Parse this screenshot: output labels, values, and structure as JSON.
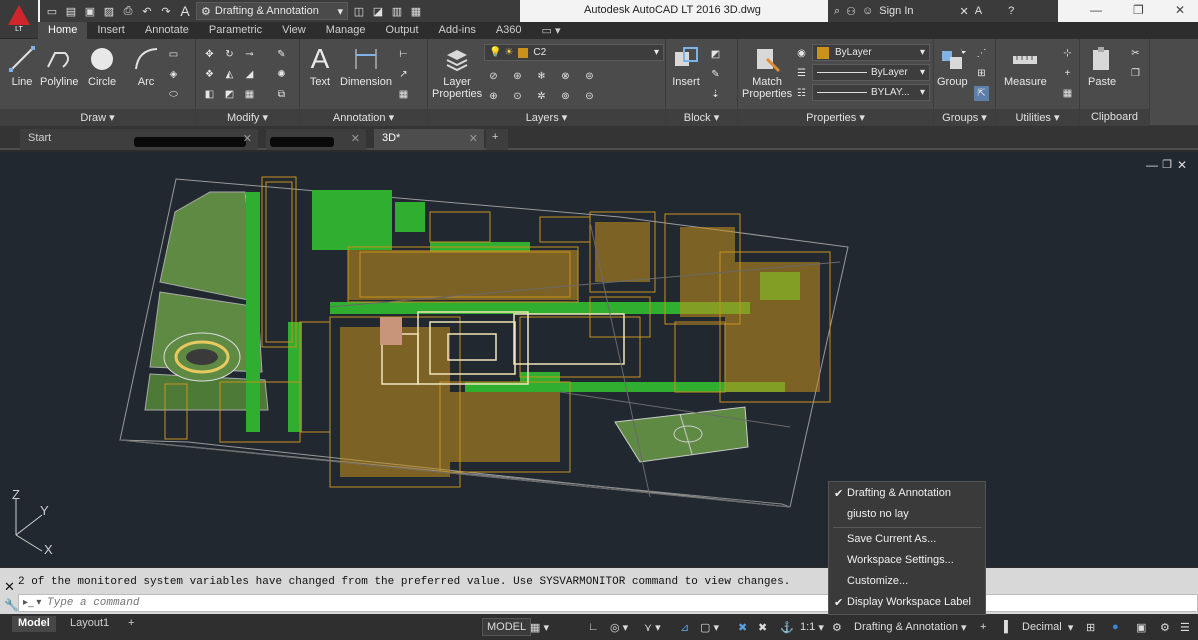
{
  "app": {
    "title": "Autodesk AutoCAD LT 2016    3D.dwg",
    "logo_text": "LT",
    "workspace": "Drafting & Annotation"
  },
  "signin": {
    "label": "Sign In"
  },
  "ribbon_tabs": [
    "Home",
    "Insert",
    "Annotate",
    "Parametric",
    "View",
    "Manage",
    "Output",
    "Add-ins",
    "A360"
  ],
  "panels": {
    "draw": "Draw",
    "modify": "Modify",
    "annotation": "Annotation",
    "layers": "Layers",
    "block": "Block",
    "properties": "Properties",
    "groups": "Groups",
    "utilities": "Utilities",
    "clipboard": "Clipboard"
  },
  "tools": {
    "line": "Line",
    "polyline": "Polyline",
    "circle": "Circle",
    "arc": "Arc",
    "text": "Text",
    "dimension": "Dimension",
    "layer_properties": "Layer\nProperties",
    "insert": "Insert",
    "match_properties": "Match\nProperties",
    "group": "Group",
    "measure": "Measure",
    "paste": "Paste"
  },
  "layer_current": "C2",
  "props": {
    "color": "ByLayer",
    "linetype": "ByLayer",
    "lineweight": "BYLAY..."
  },
  "doc_tabs": {
    "start": "Start",
    "active": "3D*"
  },
  "viewport": {
    "axis_z": "Z",
    "axis_y": "Y",
    "axis_x": "X"
  },
  "colors": {
    "building": "#c8921c",
    "tree": "#2fae2f",
    "green_area": "#5f8a44",
    "background": "#212830",
    "accent": "#d0262b"
  },
  "cmd": {
    "history": "2 of the monitored system variables have changed from the preferred value. Use SYSVARMONITOR command to view changes.",
    "placeholder": "Type a command"
  },
  "layout_tabs": {
    "model": "Model",
    "layout": "Layout1"
  },
  "status": {
    "model": "MODEL",
    "scale": "1:1",
    "workspace": "Drafting & Annotation",
    "units": "Decimal"
  },
  "menu": {
    "items": [
      {
        "label": "Drafting & Annotation",
        "checked": true
      },
      {
        "label": "giusto no lay",
        "checked": false
      },
      {
        "label": "Save Current As...",
        "checked": false
      },
      {
        "label": "Workspace Settings...",
        "checked": false
      },
      {
        "label": "Customize...",
        "checked": false
      },
      {
        "label": "Display Workspace Label",
        "checked": true
      }
    ]
  }
}
